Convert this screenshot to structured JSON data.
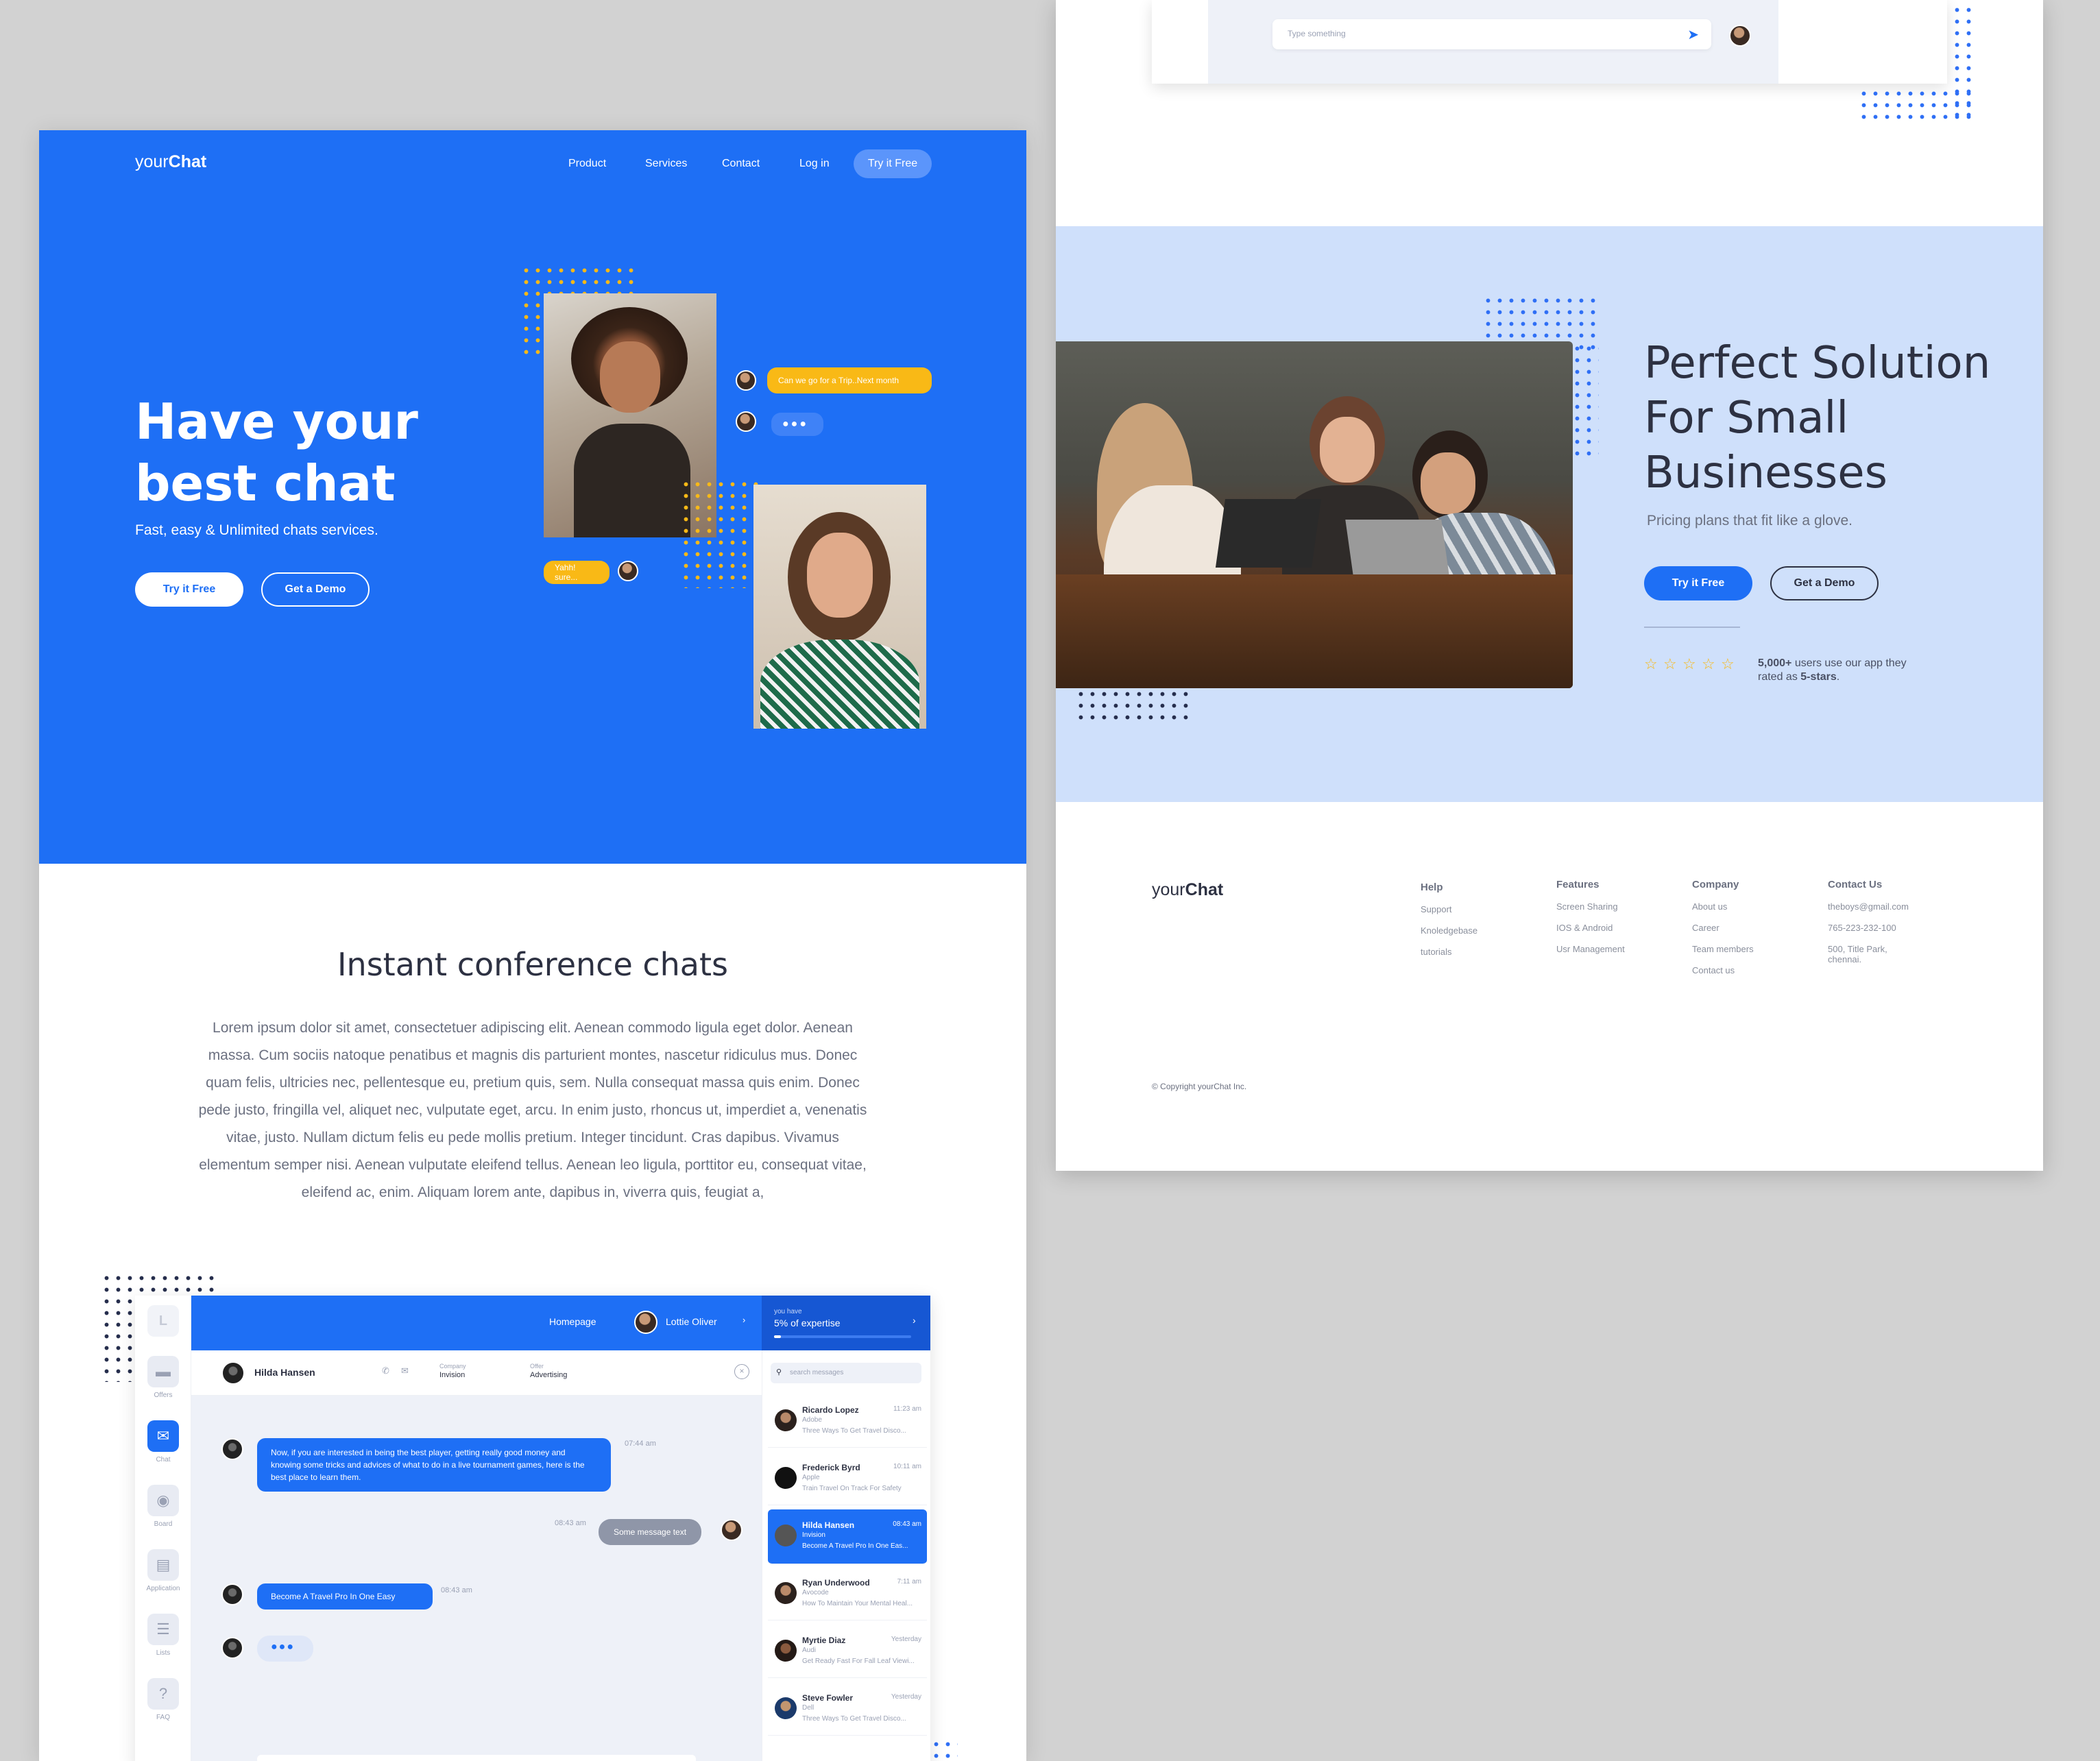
{
  "brand": {
    "prefix": "your",
    "name": "Chat"
  },
  "nav": {
    "product": "Product",
    "services": "Services",
    "contact": "Contact",
    "login": "Log in",
    "cta": "Try it Free"
  },
  "hero": {
    "title_line1": "Have your",
    "title_line2": "best chat",
    "subtitle": "Fast, easy & Unlimited chats services.",
    "primary": "Try it Free",
    "secondary": "Get a Demo",
    "bubble_question": "Can we go for a Trip..Next month",
    "bubble_reply": "Yahh! sure..."
  },
  "conference": {
    "title": "Instant conference chats",
    "body": "Lorem ipsum dolor sit amet, consectetuer adipiscing elit. Aenean commodo ligula eget dolor. Aenean massa. Cum sociis natoque penatibus et magnis dis parturient montes, nascetur ridiculus mus. Donec quam felis, ultricies nec, pellentesque eu, pretium quis, sem. Nulla consequat massa quis enim. Donec pede justo, fringilla vel, aliquet nec, vulputate eget, arcu. In enim justo, rhoncus ut, imperdiet a, venenatis vitae, justo. Nullam dictum felis eu pede mollis pretium. Integer tincidunt. Cras dapibus. Vivamus elementum semper nisi. Aenean vulputate eleifend tellus. Aenean leo ligula, porttitor eu, consequat vitae, eleifend ac, enim. Aliquam lorem ante, dapibus in, viverra quis, feugiat a,"
  },
  "app": {
    "logo_letter": "L",
    "sidebar": [
      {
        "label": "Offers",
        "icon": "briefcase-icon"
      },
      {
        "label": "Chat",
        "icon": "chat-icon"
      },
      {
        "label": "Board",
        "icon": "board-icon"
      },
      {
        "label": "Application",
        "icon": "application-icon"
      },
      {
        "label": "Lists",
        "icon": "list-icon"
      },
      {
        "label": "FAQ",
        "icon": "question-icon"
      }
    ],
    "topbar": {
      "homepage": "Homepage",
      "user": "Lottie Oliver",
      "expertise_small": "you have",
      "expertise": "5% of expertise"
    },
    "expertise_progress": 0.05,
    "chat_header": {
      "name": "Hilda Hansen",
      "company_label": "Company",
      "company": "Invision",
      "offer_label": "Offer",
      "offer": "Advertising"
    },
    "messages": {
      "m1": "Now, if you are interested in being the best player, getting really good money and knowing some tricks and advices of what to do in a live tournament games, here is the best place to learn them.",
      "m1_time": "07:44 am",
      "m2": "Some message text",
      "m2_time": "08:43 am",
      "m3": "Become A Travel Pro In One Easy",
      "m3_time": "08:43 am"
    },
    "search_placeholder": "search messages",
    "contacts": [
      {
        "name": "Ricardo Lopez",
        "company": "Adobe",
        "text": "Three Ways To Get Travel Disco...",
        "time": "11:23 am"
      },
      {
        "name": "Frederick Byrd",
        "company": "Apple",
        "text": "Train Travel On Track For Safety",
        "time": "10:11 am"
      },
      {
        "name": "Hilda Hansen",
        "company": "Invision",
        "text": "Become A Travel Pro In One Eas...",
        "time": "08:43 am"
      },
      {
        "name": "Ryan Underwood",
        "company": "Avocode",
        "text": "How To Maintain Your Mental Heal...",
        "time": "7:11 am"
      },
      {
        "name": "Myrtie Diaz",
        "company": "Audi",
        "text": "Get Ready Fast For Fall Leaf Viewi...",
        "time": "Yesterday"
      },
      {
        "name": "Steve Fowler",
        "company": "Dell",
        "text": "Three Ways To Get Travel Disco...",
        "time": "Yesterday"
      }
    ]
  },
  "page2": {
    "input_placeholder": "Type something",
    "solution": {
      "title_line1": "Perfect Solution",
      "title_line2": "For Small",
      "title_line3": "Businesses",
      "subtitle": "Pricing plans that fit like a glove.",
      "primary": "Try it Free",
      "secondary": "Get a Demo",
      "rating_count": "5,000+",
      "rating_text1": " users use our app they",
      "rating_text2": "rated as ",
      "rating_stars": "5-stars",
      "rating_end": ".",
      "stars": 5
    },
    "footer": {
      "help": {
        "title": "Help",
        "items": [
          "Support",
          "Knoledgebase",
          "tutorials"
        ]
      },
      "features": {
        "title": "Features",
        "items": [
          "Screen Sharing",
          "IOS & Android",
          "Usr Management"
        ]
      },
      "company": {
        "title": "Company",
        "items": [
          "About us",
          "Career",
          "Team members",
          "Contact us"
        ]
      },
      "contact": {
        "title": "Contact Us",
        "items": [
          "theboys@gmail.com",
          "765-223-232-100",
          "500, Title Park,",
          "chennai."
        ]
      },
      "copyright": "© Copyright yourChat Inc."
    }
  },
  "colors": {
    "primary": "#1e6ff5",
    "accent": "#f9b916",
    "light_blue": "#cfe0fb",
    "dark": "#2d3142"
  }
}
